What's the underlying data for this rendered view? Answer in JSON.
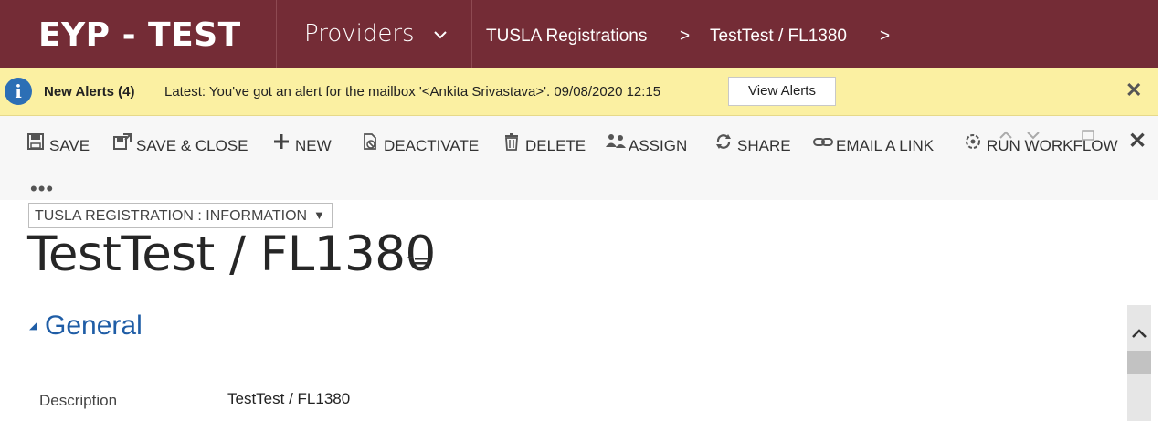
{
  "topbar": {
    "brand": "EYP - TEST",
    "area": "Providers",
    "entity": "TUSLA Registrations",
    "record": "TestTest / FL1380",
    "chevron": ">",
    "dropdown_icon": "chevron-down-icon"
  },
  "alert": {
    "title": "New Alerts (4)",
    "text": "Latest: You've got an alert for the mailbox '<Ankita Srivastava>'. 09/08/2020 12:15",
    "button": "View Alerts",
    "icon": "info-icon",
    "bg_color": "#fbf0a2"
  },
  "commands": [
    {
      "label": "SAVE",
      "icon": "save-icon"
    },
    {
      "label": "SAVE & CLOSE",
      "icon": "save-close-icon"
    },
    {
      "label": "NEW",
      "icon": "plus-icon"
    },
    {
      "label": "DEACTIVATE",
      "icon": "deactivate-icon"
    },
    {
      "label": "DELETE",
      "icon": "trash-icon"
    },
    {
      "label": "ASSIGN",
      "icon": "assign-icon"
    },
    {
      "label": "SHARE",
      "icon": "share-icon"
    },
    {
      "label": "EMAIL A LINK",
      "icon": "link-icon"
    },
    {
      "label": "RUN WORKFLOW",
      "icon": "workflow-icon"
    }
  ],
  "form": {
    "selector": "TUSLA REGISTRATION : INFORMATION",
    "title": "TestTest / FL1380",
    "section": "General",
    "fields": [
      {
        "label": "Description",
        "value": "TestTest / FL1380"
      }
    ]
  },
  "colors": {
    "brand": "#742c36",
    "section_title": "#1f5da6"
  }
}
